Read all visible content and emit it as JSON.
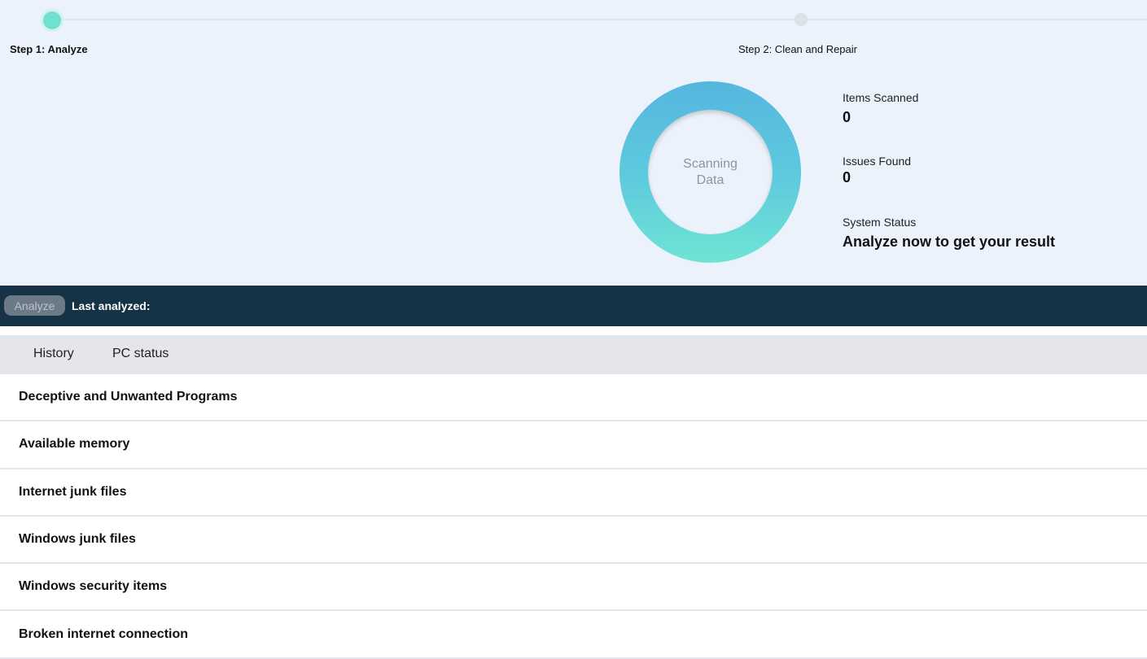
{
  "steps": {
    "step1": "Step 1: Analyze",
    "step2": "Step 2: Clean and Repair"
  },
  "scan_ring": {
    "line1": "Scanning",
    "line2": "Data"
  },
  "stats": {
    "items_scanned_label": "Items Scanned",
    "items_scanned_value": "0",
    "issues_found_label": "Issues Found",
    "issues_found_value": "0",
    "system_status_label": "System Status",
    "system_status_value": "Analyze now to get your result"
  },
  "action_bar": {
    "analyze_label": "Analyze",
    "last_analyzed_label": "Last analyzed:"
  },
  "tabs": [
    {
      "label": "History"
    },
    {
      "label": "PC status"
    }
  ],
  "items": [
    {
      "label": "Deceptive and Unwanted Programs"
    },
    {
      "label": "Available memory"
    },
    {
      "label": "Internet junk files"
    },
    {
      "label": "Windows junk files"
    },
    {
      "label": "Windows security items"
    },
    {
      "label": "Broken internet connection"
    }
  ],
  "colors": {
    "accent": "#6fe0d1",
    "ring_top": "#55b6df",
    "ring_bottom": "#6fe4d4",
    "bar": "#163246"
  }
}
